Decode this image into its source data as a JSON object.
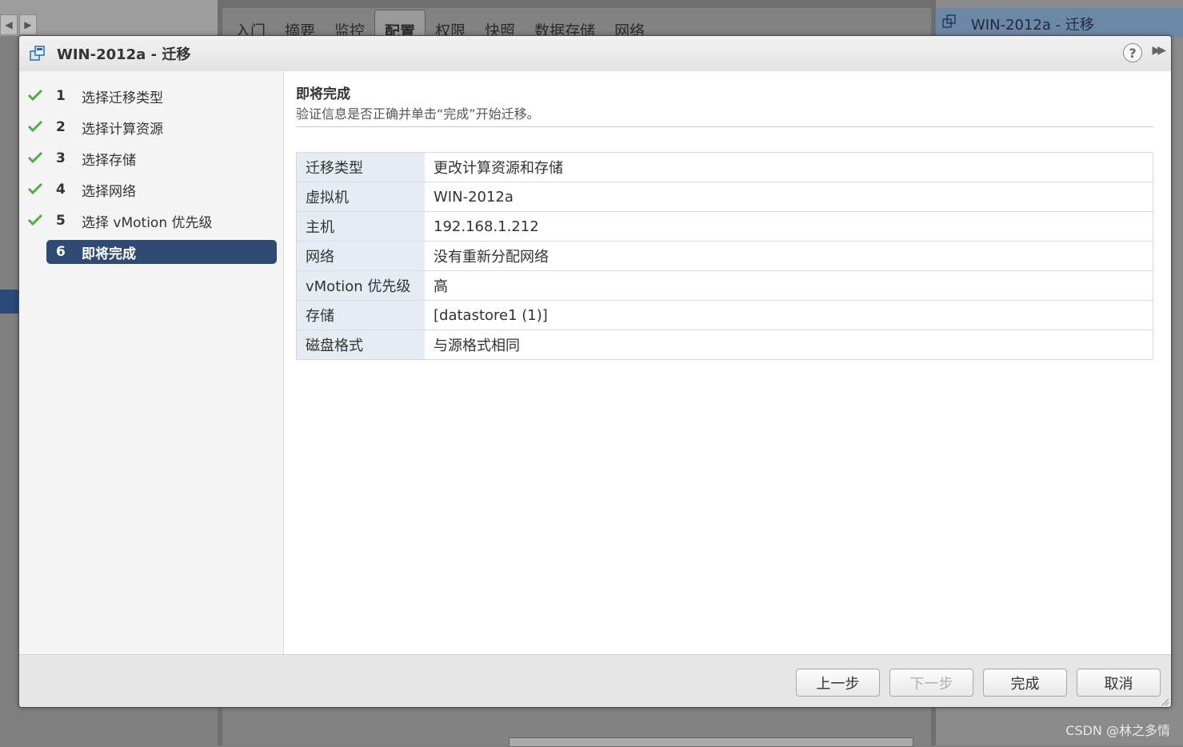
{
  "background": {
    "tabs": [
      "入门",
      "摘要",
      "监控",
      "配置",
      "权限",
      "快照",
      "数据存储",
      "网络"
    ],
    "active_tab_index": 3,
    "right_panel_title": "WIN-2012a - 迁移",
    "watermark": "CSDN @林之多情"
  },
  "dialog": {
    "title": "WIN-2012a - 迁移",
    "help_label": "?",
    "steps": [
      {
        "num": "1",
        "label": "选择迁移类型",
        "done": true
      },
      {
        "num": "2",
        "label": "选择计算资源",
        "done": true
      },
      {
        "num": "3",
        "label": "选择存储",
        "done": true
      },
      {
        "num": "4",
        "label": "选择网络",
        "done": true
      },
      {
        "num": "5",
        "label": "选择 vMotion 优先级",
        "done": true
      },
      {
        "num": "6",
        "label": "即将完成",
        "done": false
      }
    ],
    "active_step_index": 5,
    "content": {
      "title": "即将完成",
      "subtitle": "验证信息是否正确并单击“完成”开始迁移。",
      "rows": [
        {
          "key": "迁移类型",
          "value": "更改计算资源和存储"
        },
        {
          "key": "虚拟机",
          "value": "WIN-2012a"
        },
        {
          "key": "主机",
          "value": "192.168.1.212"
        },
        {
          "key": "网络",
          "value": "没有重新分配网络"
        },
        {
          "key": "vMotion 优先级",
          "value": "高"
        },
        {
          "key": "存储",
          "value": "[datastore1 (1)]"
        },
        {
          "key": "磁盘格式",
          "value": "与源格式相同"
        }
      ]
    },
    "buttons": {
      "back": "上一步",
      "next": "下一步",
      "finish": "完成",
      "cancel": "取消"
    },
    "colors": {
      "active_step": "#2f4b74",
      "check": "#4caf3f",
      "key_cell": "#e5ecf4"
    }
  }
}
